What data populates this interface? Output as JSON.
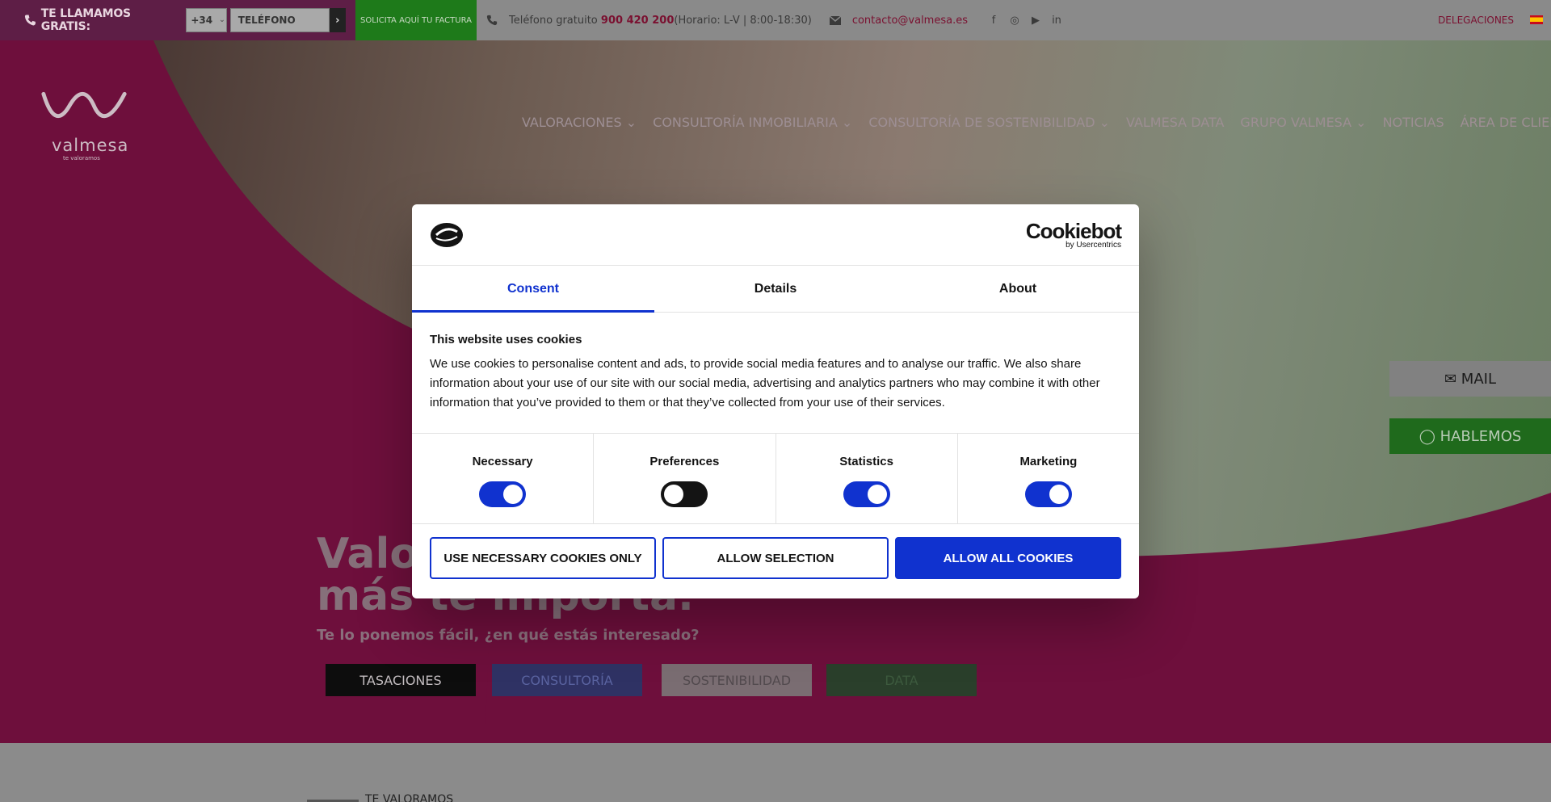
{
  "topbar": {
    "callme_label": "TE LLAMAMOS GRATIS:",
    "prefix": "+34",
    "phone_placeholder": "TELÉFONO",
    "go": "›",
    "invoice_label": "SOLICITA AQUÍ TU FACTURA",
    "free_tel_prefix": "Teléfono gratuito",
    "free_tel_number": "900 420 200",
    "free_tel_hours": "(Horario: L-V | 8:00-18:30)",
    "email": "contacto@valmesa.es",
    "social": [
      "f",
      "◎",
      "▶",
      "in"
    ],
    "delegaciones": "DELEGACIONES"
  },
  "nav": {
    "items": [
      "VALORACIONES ⌄",
      "CONSULTORÍA INMOBILIARIA ⌄",
      "CONSULTORÍA DE SOSTENIBILIDAD ⌄",
      "VALMESA DATA",
      "GRUPO VALMESA ⌄",
      "NOTICIAS",
      "ÁREA DE CLIENTES"
    ]
  },
  "logo": {
    "name": "valmesa",
    "tagline": "te valoramos"
  },
  "hero": {
    "title_line1": "Valo",
    "title_line2": "más te importa.",
    "subtitle": "Te lo ponemos fácil, ¿en qué estás interesado?",
    "ctas": [
      "TASACIONES",
      "CONSULTORÍA",
      "SOSTENIBILIDAD",
      "DATA"
    ]
  },
  "side": {
    "mail": "✉ MAIL",
    "talk": "◯ HABLEMOS"
  },
  "below": {
    "label": "TE VALORAMOS"
  },
  "cookie": {
    "brand": "Cookiebot",
    "brand_sub": "by Usercentrics",
    "tabs": [
      "Consent",
      "Details",
      "About"
    ],
    "heading": "This website uses cookies",
    "body": "We use cookies to personalise content and ads, to provide social media features and to analyse our traffic. We also share information about your use of our site with our social media, advertising and analytics partners who may combine it with other information that you’ve provided to them or that they’ve collected from your use of their services.",
    "toggles": [
      {
        "label": "Necessary",
        "on": true
      },
      {
        "label": "Preferences",
        "on": false
      },
      {
        "label": "Statistics",
        "on": true
      },
      {
        "label": "Marketing",
        "on": true
      }
    ],
    "buttons": {
      "necessary_only": "USE NECESSARY COOKIES ONLY",
      "allow_selection": "ALLOW SELECTION",
      "allow_all": "ALLOW ALL COOKIES"
    }
  },
  "colors": {
    "accent": "#1032cf",
    "brand": "#6e0f3c",
    "green": "#1f6a1c"
  }
}
